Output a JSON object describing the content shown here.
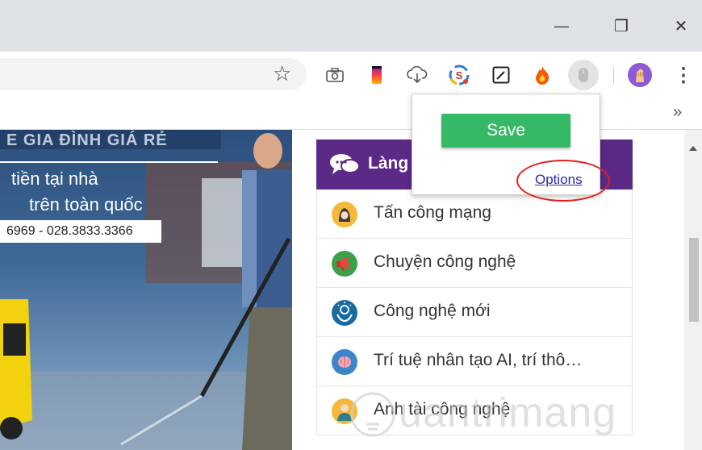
{
  "window": {
    "minimize_glyph": "—",
    "restore_glyph": "❐",
    "close_glyph": "✕"
  },
  "toolbar": {
    "star_glyph": "☆",
    "menu_glyph": "⋮",
    "icons": [
      "camera-icon",
      "phone-gradient-icon",
      "cloud-download-icon",
      "s-circle-icon",
      "pen-box-icon",
      "flame-icon",
      "mouse-icon",
      "avatar"
    ]
  },
  "bookmarks": {
    "overflow_glyph": "»"
  },
  "banner": {
    "heading": "E GIA ĐÌNH GIÁ RẺ",
    "line1": "tiền tại nhà",
    "line2": "trên toàn quốc",
    "phone": "6969 - 028.3833.3366"
  },
  "sidebar": {
    "header_label": "Làng",
    "items": [
      {
        "label": "Tấn công mạng",
        "color": "#f6b73c"
      },
      {
        "label": "Chuyện công nghệ",
        "color": "#3aa14a"
      },
      {
        "label": "Công nghệ mới",
        "color": "#1b6aa3"
      },
      {
        "label": "Trí tuệ nhân tạo AI, trí thô…",
        "color": "#3a86c8"
      },
      {
        "label": "Anh tài công nghệ",
        "color": "#f6b73c"
      }
    ]
  },
  "popup": {
    "save_label": "Save",
    "options_label": "Options"
  },
  "watermark": {
    "text": "uantrimang"
  },
  "colors": {
    "accent_green": "#36b967",
    "sidebar_purple": "#5b2a86",
    "link": "#2a2aa8",
    "highlight": "#e32020"
  }
}
